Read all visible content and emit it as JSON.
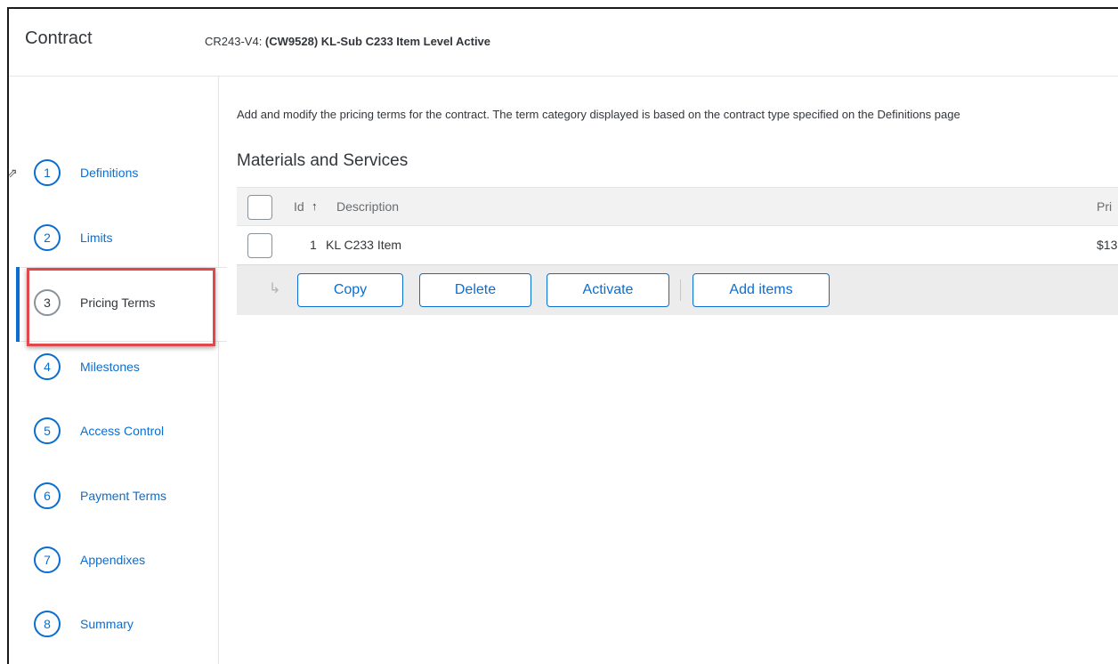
{
  "header": {
    "app_title": "Contract",
    "doc_prefix": "CR243-V4: ",
    "doc_name": "(CW9528) KL-Sub C233 Item Level Active"
  },
  "sidebar": {
    "steps": [
      {
        "num": "1",
        "label": "Definitions"
      },
      {
        "num": "2",
        "label": "Limits"
      },
      {
        "num": "3",
        "label": "Pricing Terms",
        "active": true
      },
      {
        "num": "4",
        "label": "Milestones"
      },
      {
        "num": "5",
        "label": "Access Control"
      },
      {
        "num": "6",
        "label": "Payment Terms"
      },
      {
        "num": "7",
        "label": "Appendixes"
      },
      {
        "num": "8",
        "label": "Summary"
      }
    ]
  },
  "main": {
    "intro": "Add and modify the pricing terms for the contract. The term category displayed is based on the contract type specified on the Definitions page",
    "section_title": "Materials and Services",
    "table": {
      "columns": [
        "Id",
        "Description",
        "Pri"
      ],
      "sort_icon": "↑",
      "rows": [
        {
          "id": "1",
          "description": "KL C233 Item",
          "price": "$13"
        }
      ]
    },
    "actions": {
      "return_icon": "↳",
      "copy": "Copy",
      "delete": "Delete",
      "activate": "Activate",
      "add_items": "Add items"
    }
  },
  "colors": {
    "accent": "#0a6ed1",
    "highlight": "#e2474b"
  }
}
